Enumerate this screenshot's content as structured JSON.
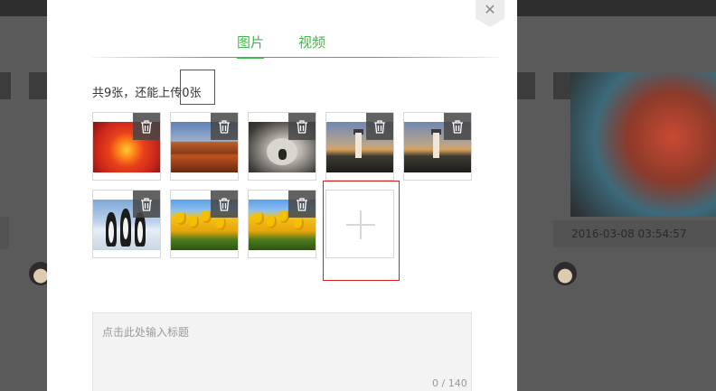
{
  "background": {
    "timestamp": "2016-03-08 03:54:57"
  },
  "modal": {
    "close_icon": "close-icon",
    "tabs": [
      {
        "label": "图片",
        "active": true
      },
      {
        "label": "视频",
        "active": false
      }
    ],
    "count_text": "共9张，还能上传0张",
    "images": [
      {
        "name": "red-flower",
        "icon": "trash-icon"
      },
      {
        "name": "desert",
        "icon": "trash-icon"
      },
      {
        "name": "koala",
        "icon": "trash-icon"
      },
      {
        "name": "lighthouse",
        "icon": "trash-icon"
      },
      {
        "name": "lighthouse",
        "icon": "trash-icon"
      },
      {
        "name": "penguins",
        "icon": "trash-icon"
      },
      {
        "name": "tulips",
        "icon": "trash-icon"
      },
      {
        "name": "tulips",
        "icon": "trash-icon"
      }
    ],
    "add_button_icon": "plus-icon",
    "title_input": {
      "placeholder": "点击此处输入标题",
      "value": ""
    },
    "char_counter": "0 / 140"
  },
  "colors": {
    "accent": "#3fb848",
    "highlight": "#d81e1e"
  }
}
